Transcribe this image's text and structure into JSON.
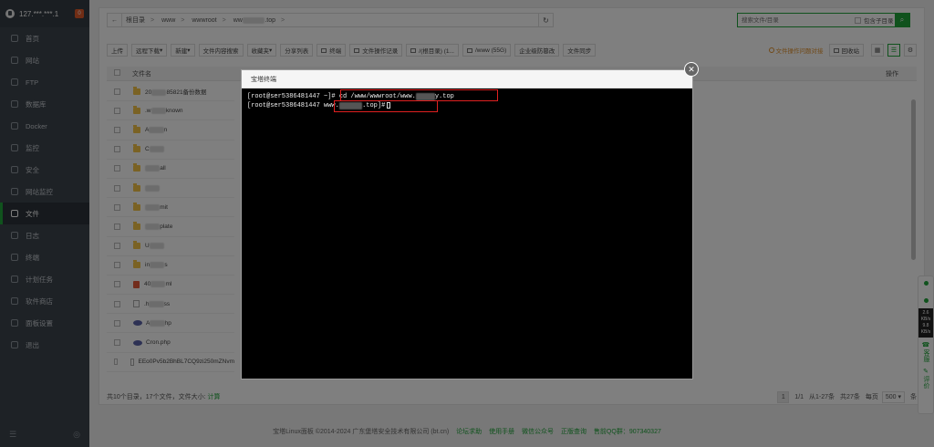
{
  "sidebar": {
    "server_ip": "127.***.***.1",
    "badge": "0",
    "items": [
      {
        "label": "首页",
        "icon": "home-icon"
      },
      {
        "label": "网站",
        "icon": "globe-icon"
      },
      {
        "label": "FTP",
        "icon": "ftp-icon"
      },
      {
        "label": "数据库",
        "icon": "database-icon"
      },
      {
        "label": "Docker",
        "icon": "docker-icon"
      },
      {
        "label": "监控",
        "icon": "monitor-icon"
      },
      {
        "label": "安全",
        "icon": "shield-icon"
      },
      {
        "label": "网站监控",
        "icon": "site-monitor-icon"
      },
      {
        "label": "文件",
        "icon": "folder-icon",
        "active": true
      },
      {
        "label": "日志",
        "icon": "log-icon"
      },
      {
        "label": "终端",
        "icon": "terminal-icon"
      },
      {
        "label": "计划任务",
        "icon": "cron-icon"
      },
      {
        "label": "软件商店",
        "icon": "store-icon"
      },
      {
        "label": "面板设置",
        "icon": "gear-icon"
      },
      {
        "label": "退出",
        "icon": "logout-icon"
      }
    ]
  },
  "path": {
    "crumbs": [
      "根目录",
      "www",
      "wwwroot",
      "ww",
      ".top"
    ]
  },
  "search": {
    "placeholder": "搜索文件/目录",
    "subdir_label": "包含子目录"
  },
  "toolbar": {
    "buttons": [
      "上传",
      "远程下载",
      "新建",
      "文件内容搜索",
      "收藏夹",
      "分享列表",
      "终端",
      "文件操作记录",
      "/(根目录) (1...",
      "/www (55G)",
      "企业级防篡改",
      "文件同步"
    ],
    "warning": "文件操作问题对接",
    "recycle": "回收站"
  },
  "table": {
    "col_name": "文件名",
    "col_ops": "操作",
    "rows": [
      {
        "type": "folder",
        "pre": "20",
        "post": "85821备份数据"
      },
      {
        "type": "folder",
        "pre": ".w",
        "post": "known"
      },
      {
        "type": "folder",
        "pre": "A",
        "post": "n"
      },
      {
        "type": "folder",
        "pre": "C",
        "post": ""
      },
      {
        "type": "folder",
        "pre": "",
        "post": "all"
      },
      {
        "type": "folder",
        "pre": "",
        "post": ""
      },
      {
        "type": "folder",
        "pre": "",
        "post": "mit"
      },
      {
        "type": "folder",
        "pre": "",
        "post": "plate"
      },
      {
        "type": "folder",
        "pre": "U",
        "post": ""
      },
      {
        "type": "folder",
        "pre": "in",
        "post": "s"
      },
      {
        "type": "html",
        "pre": "40",
        "post": "ml"
      },
      {
        "type": "file",
        "pre": ".h",
        "post": "ss"
      },
      {
        "type": "php",
        "pre": "A",
        "post": "hp"
      },
      {
        "type": "php",
        "pre": "Cron.php",
        "post": ""
      },
      {
        "type": "file",
        "pre": "EEo0Pv5b2BhBL7CQ9zi250mZNvm",
        "post": ""
      }
    ]
  },
  "footer": {
    "summary": "共10个目录，17个文件，文件大小:",
    "calc": "计算",
    "page": "1",
    "page_of": "1/1",
    "range": "从1-27条",
    "total": "共27条",
    "per_page_label": "每页",
    "per_page": "500",
    "per_page_unit": "条"
  },
  "bottom": {
    "copyright": "宝塔Linux面板 ©2014-2024 广东堡塔安全技术有限公司 (bt.cn)",
    "links": [
      "论坛求助",
      "使用手册",
      "微信公众号",
      "正版查询",
      "售前QQ群：907340327"
    ]
  },
  "floatw": {
    "up": "2.6",
    "up_unit": "KB/s",
    "down": "9.8",
    "down_unit": "KB/s",
    "service": "客服",
    "review": "评价"
  },
  "terminal": {
    "title": "宝塔终端",
    "line1_prompt": "[root@ser5386481447 ~]#",
    "line1_cmd_a": "cd /www/wwwroot/www.",
    "line1_cmd_b": "y.top",
    "line2_prompt": "[root@ser5386481447",
    "line2_dir_a": "www.",
    "line2_dir_b": ".top]#"
  }
}
